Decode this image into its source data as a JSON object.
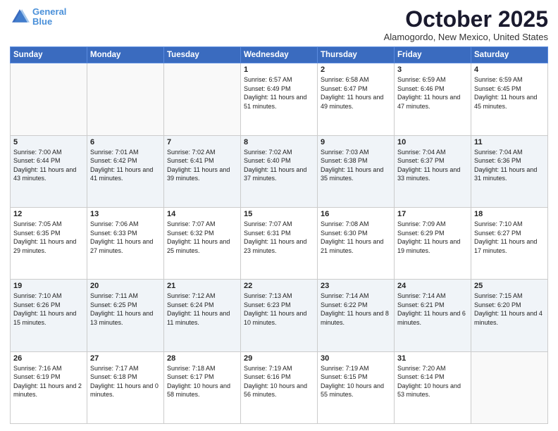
{
  "logo": {
    "line1": "General",
    "line2": "Blue"
  },
  "header": {
    "month": "October 2025",
    "location": "Alamogordo, New Mexico, United States"
  },
  "weekdays": [
    "Sunday",
    "Monday",
    "Tuesday",
    "Wednesday",
    "Thursday",
    "Friday",
    "Saturday"
  ],
  "rows": [
    [
      {
        "day": "",
        "info": ""
      },
      {
        "day": "",
        "info": ""
      },
      {
        "day": "",
        "info": ""
      },
      {
        "day": "1",
        "info": "Sunrise: 6:57 AM\nSunset: 6:49 PM\nDaylight: 11 hours\nand 51 minutes."
      },
      {
        "day": "2",
        "info": "Sunrise: 6:58 AM\nSunset: 6:47 PM\nDaylight: 11 hours\nand 49 minutes."
      },
      {
        "day": "3",
        "info": "Sunrise: 6:59 AM\nSunset: 6:46 PM\nDaylight: 11 hours\nand 47 minutes."
      },
      {
        "day": "4",
        "info": "Sunrise: 6:59 AM\nSunset: 6:45 PM\nDaylight: 11 hours\nand 45 minutes."
      }
    ],
    [
      {
        "day": "5",
        "info": "Sunrise: 7:00 AM\nSunset: 6:44 PM\nDaylight: 11 hours\nand 43 minutes."
      },
      {
        "day": "6",
        "info": "Sunrise: 7:01 AM\nSunset: 6:42 PM\nDaylight: 11 hours\nand 41 minutes."
      },
      {
        "day": "7",
        "info": "Sunrise: 7:02 AM\nSunset: 6:41 PM\nDaylight: 11 hours\nand 39 minutes."
      },
      {
        "day": "8",
        "info": "Sunrise: 7:02 AM\nSunset: 6:40 PM\nDaylight: 11 hours\nand 37 minutes."
      },
      {
        "day": "9",
        "info": "Sunrise: 7:03 AM\nSunset: 6:38 PM\nDaylight: 11 hours\nand 35 minutes."
      },
      {
        "day": "10",
        "info": "Sunrise: 7:04 AM\nSunset: 6:37 PM\nDaylight: 11 hours\nand 33 minutes."
      },
      {
        "day": "11",
        "info": "Sunrise: 7:04 AM\nSunset: 6:36 PM\nDaylight: 11 hours\nand 31 minutes."
      }
    ],
    [
      {
        "day": "12",
        "info": "Sunrise: 7:05 AM\nSunset: 6:35 PM\nDaylight: 11 hours\nand 29 minutes."
      },
      {
        "day": "13",
        "info": "Sunrise: 7:06 AM\nSunset: 6:33 PM\nDaylight: 11 hours\nand 27 minutes."
      },
      {
        "day": "14",
        "info": "Sunrise: 7:07 AM\nSunset: 6:32 PM\nDaylight: 11 hours\nand 25 minutes."
      },
      {
        "day": "15",
        "info": "Sunrise: 7:07 AM\nSunset: 6:31 PM\nDaylight: 11 hours\nand 23 minutes."
      },
      {
        "day": "16",
        "info": "Sunrise: 7:08 AM\nSunset: 6:30 PM\nDaylight: 11 hours\nand 21 minutes."
      },
      {
        "day": "17",
        "info": "Sunrise: 7:09 AM\nSunset: 6:29 PM\nDaylight: 11 hours\nand 19 minutes."
      },
      {
        "day": "18",
        "info": "Sunrise: 7:10 AM\nSunset: 6:27 PM\nDaylight: 11 hours\nand 17 minutes."
      }
    ],
    [
      {
        "day": "19",
        "info": "Sunrise: 7:10 AM\nSunset: 6:26 PM\nDaylight: 11 hours\nand 15 minutes."
      },
      {
        "day": "20",
        "info": "Sunrise: 7:11 AM\nSunset: 6:25 PM\nDaylight: 11 hours\nand 13 minutes."
      },
      {
        "day": "21",
        "info": "Sunrise: 7:12 AM\nSunset: 6:24 PM\nDaylight: 11 hours\nand 11 minutes."
      },
      {
        "day": "22",
        "info": "Sunrise: 7:13 AM\nSunset: 6:23 PM\nDaylight: 11 hours\nand 10 minutes."
      },
      {
        "day": "23",
        "info": "Sunrise: 7:14 AM\nSunset: 6:22 PM\nDaylight: 11 hours\nand 8 minutes."
      },
      {
        "day": "24",
        "info": "Sunrise: 7:14 AM\nSunset: 6:21 PM\nDaylight: 11 hours\nand 6 minutes."
      },
      {
        "day": "25",
        "info": "Sunrise: 7:15 AM\nSunset: 6:20 PM\nDaylight: 11 hours\nand 4 minutes."
      }
    ],
    [
      {
        "day": "26",
        "info": "Sunrise: 7:16 AM\nSunset: 6:19 PM\nDaylight: 11 hours\nand 2 minutes."
      },
      {
        "day": "27",
        "info": "Sunrise: 7:17 AM\nSunset: 6:18 PM\nDaylight: 11 hours\nand 0 minutes."
      },
      {
        "day": "28",
        "info": "Sunrise: 7:18 AM\nSunset: 6:17 PM\nDaylight: 10 hours\nand 58 minutes."
      },
      {
        "day": "29",
        "info": "Sunrise: 7:19 AM\nSunset: 6:16 PM\nDaylight: 10 hours\nand 56 minutes."
      },
      {
        "day": "30",
        "info": "Sunrise: 7:19 AM\nSunset: 6:15 PM\nDaylight: 10 hours\nand 55 minutes."
      },
      {
        "day": "31",
        "info": "Sunrise: 7:20 AM\nSunset: 6:14 PM\nDaylight: 10 hours\nand 53 minutes."
      },
      {
        "day": "",
        "info": ""
      }
    ]
  ]
}
